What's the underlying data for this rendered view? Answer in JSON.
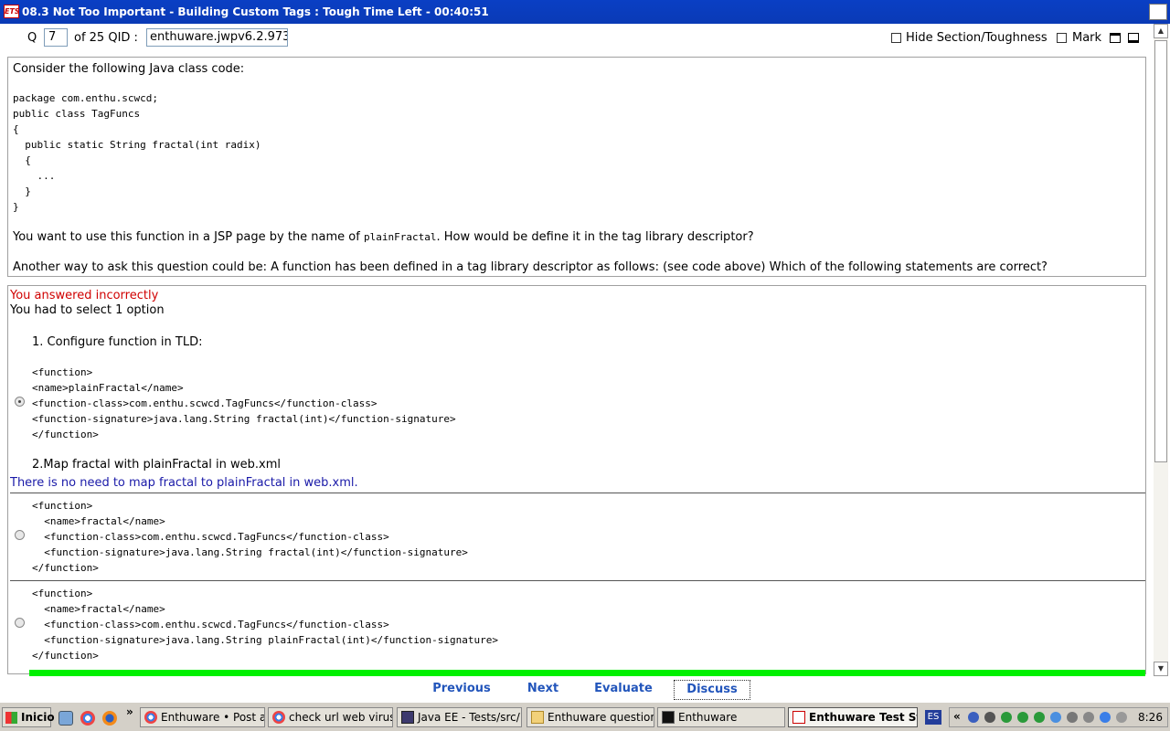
{
  "window": {
    "title": "08.3 Not Too Important - Building Custom Tags :  Tough   Time Left - 00:40:51",
    "icon_text": "ETS"
  },
  "toolbar": {
    "q_label": "Q",
    "q_number": "7",
    "qid_label": "of 25 QID :",
    "qid_value": "enthuware.jwpv6.2.973",
    "hide_section_label": "Hide Section/Toughness",
    "hide_section_checked": false,
    "mark_label": "Mark",
    "mark_checked": false
  },
  "question": {
    "intro": "Consider the following Java class code:",
    "code": [
      "package com.enthu.scwcd;",
      "public class TagFuncs",
      "{",
      "  public static String fractal(int radix)",
      "  {",
      "    ...",
      "  }",
      "}"
    ],
    "prompt_before": "You want to use this function in a JSP page by the name of ",
    "prompt_code": "plainFractal",
    "prompt_after": ". How would be define it in the tag library descriptor?",
    "alt_prompt": "Another way to ask this question could be: A function has been defined in a tag library descriptor as follows: (see code above) Which of the following statements are correct?"
  },
  "answer": {
    "status": "You answered incorrectly",
    "instruction": "You had to select 1 option",
    "options": [
      {
        "checked": true,
        "step1": "1. Configure function in TLD:",
        "code": [
          "<function>",
          "<name>plainFractal</name>",
          "<function-class>com.enthu.scwcd.TagFuncs</function-class>",
          "<function-signature>java.lang.String fractal(int)</function-signature>",
          "</function>"
        ],
        "step2": "2.Map fractal with plainFractal in web.xml",
        "explanation": "There is no need to map fractal to plainFractal in web.xml."
      },
      {
        "checked": false,
        "code": [
          "<function>",
          "  <name>fractal</name>",
          "  <function-class>com.enthu.scwcd.TagFuncs</function-class>",
          "  <function-signature>java.lang.String fractal(int)</function-signature>",
          "</function>"
        ]
      },
      {
        "checked": false,
        "code": [
          "<function>",
          "  <name>fractal</name>",
          "  <function-class>com.enthu.scwcd.TagFuncs</function-class>",
          "  <function-signature>java.lang.String plainFractal(int)</function-signature>",
          "</function>"
        ]
      }
    ]
  },
  "nav": {
    "previous": "Previous",
    "next": "Next",
    "evaluate": "Evaluate",
    "discuss": "Discuss"
  },
  "taskbar": {
    "start": "Inicio",
    "overflow": "»",
    "tasks": [
      "Enthuware • Post a ...",
      "check url web virus ...",
      "Java EE - Tests/src/...",
      "Enthuware questions",
      "Enthuware",
      "Enthuware Test St..."
    ],
    "language": "ES",
    "tray_chevron": "«",
    "clock": "8:26"
  },
  "colors": {
    "title_bar": "#0a3fc4",
    "progress": "#00f000",
    "incorrect": "#d00000",
    "explanation": "#1a1aa8",
    "nav_link": "#2255bb"
  }
}
